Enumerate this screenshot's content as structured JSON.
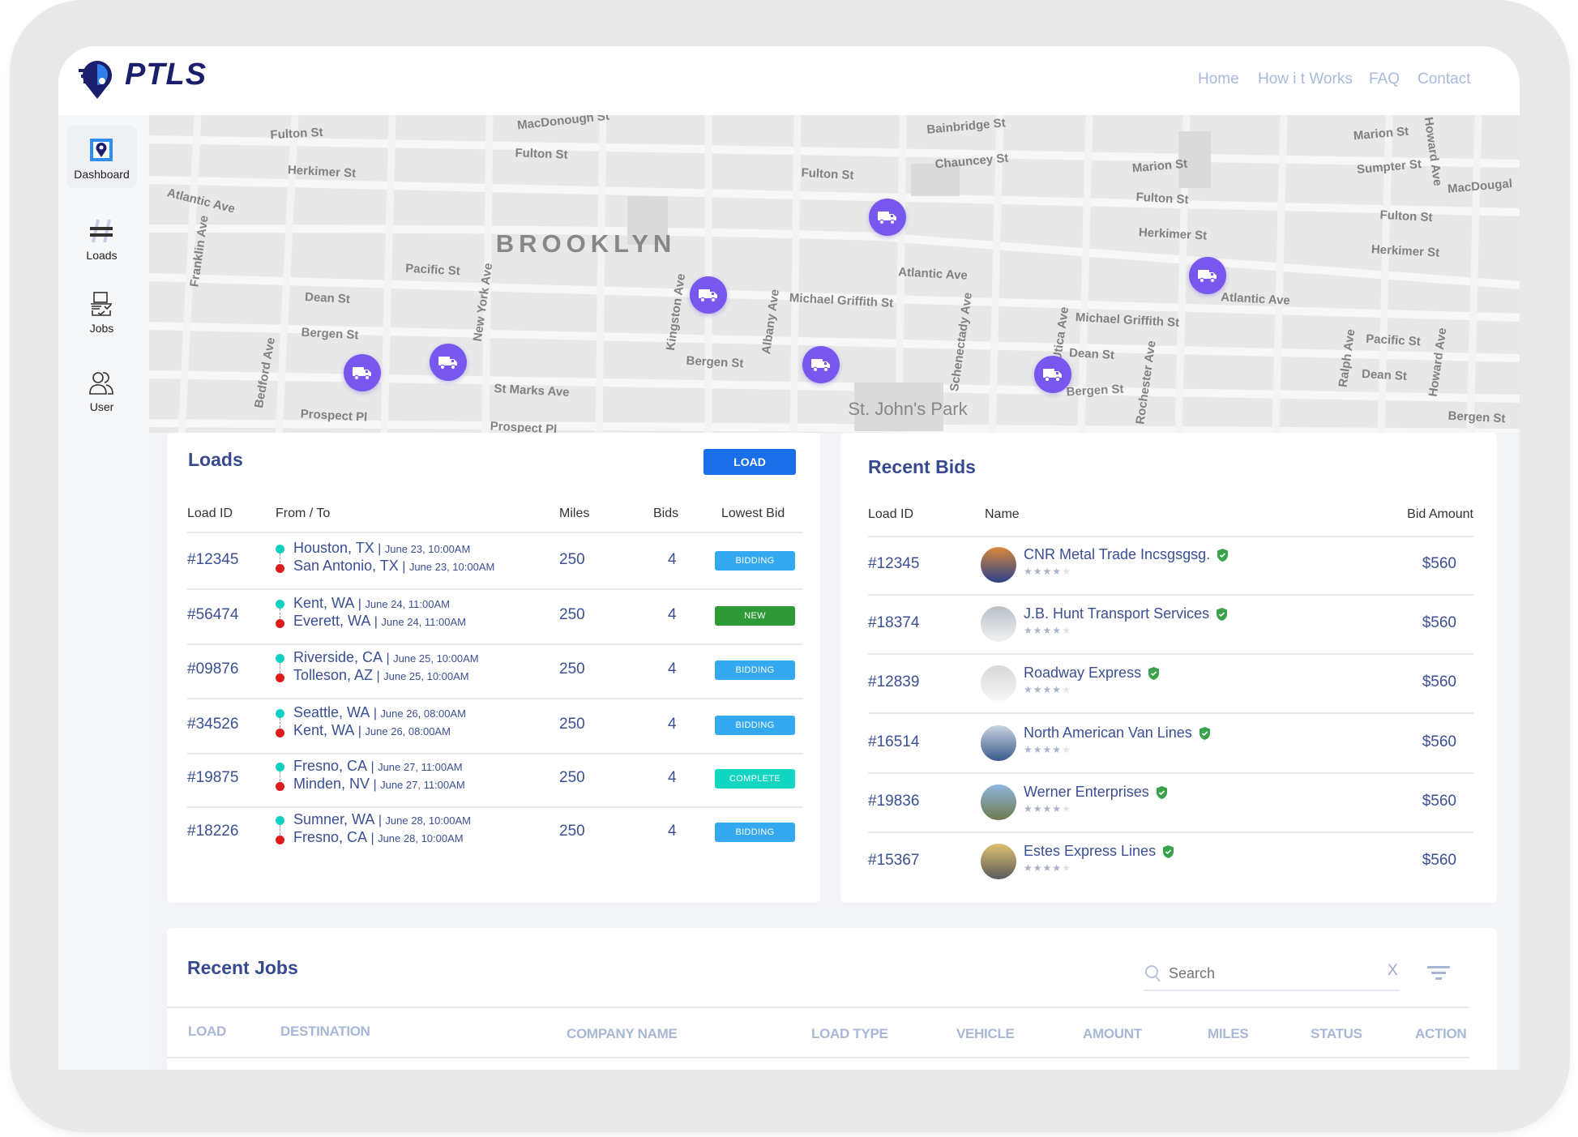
{
  "app": {
    "brand": "PTLS"
  },
  "nav": [
    {
      "label": "Home"
    },
    {
      "label": "How i t Works"
    },
    {
      "label": "FAQ"
    },
    {
      "label": "Contact"
    }
  ],
  "sidebar": {
    "items": [
      {
        "label": "Dashboard",
        "icon": "map-pin-icon",
        "active": true
      },
      {
        "label": "Loads",
        "icon": "road-icon"
      },
      {
        "label": "Jobs",
        "icon": "clipboard-icon"
      },
      {
        "label": "User",
        "icon": "users-icon"
      }
    ]
  },
  "map": {
    "marker_color": "#7857ee",
    "marker_icon": "truck-icon",
    "labels": [
      "Fulton St",
      "MacDonough St",
      "Fulton St",
      "Herkimer St",
      "Atlantic Ave",
      "Franklin Ave",
      "BROOKLYN",
      "Pacific St",
      "Dean St",
      "Bergen St",
      "New York Ave",
      "Bedford Ave",
      "Prospect Pl",
      "St Marks Ave",
      "Prospect Pl",
      "Kingston Ave",
      "Bergen St",
      "Albany Ave",
      "Michael Griffith St",
      "Fulton St",
      "Atlantic Ave",
      "Bainbridge St",
      "Chauncey St",
      "Schenectady Ave",
      "St. John's Park",
      "Utica Ave",
      "Michael Griffith St",
      "Dean St",
      "Bergen St",
      "Rochester Ave",
      "Marion St",
      "Fulton St",
      "Herkimer St",
      "Atlantic Ave",
      "Marion St",
      "Sumpter St",
      "Fulton St",
      "Herkimer St",
      "MacDougal",
      "Pacific St",
      "Dean St",
      "Ralph Ave",
      "Howard Ave",
      "Howard Ave",
      "Bergen St"
    ]
  },
  "loads": {
    "title": "Loads",
    "button": "LOAD",
    "columns": [
      "Load  ID",
      "From / To",
      "Miles",
      "Bids",
      "Lowest Bid"
    ],
    "rows": [
      {
        "id": "#12345",
        "from": "Houston, TX",
        "from_date": "June 23, 10:00AM",
        "to": "San Antonio, TX",
        "to_date": "June 23, 10:00AM",
        "miles": "250",
        "bids": "4",
        "status": "BIDDING",
        "status_color": "#35a9f0"
      },
      {
        "id": "#56474",
        "from": "Kent, WA",
        "from_date": "June 24, 11:00AM",
        "to": "Everett, WA",
        "to_date": "June 24, 11:00AM",
        "miles": "250",
        "bids": "4",
        "status": "NEW",
        "status_color": "#2e9a35"
      },
      {
        "id": "#09876",
        "from": "Riverside, CA",
        "from_date": "June 25, 10:00AM",
        "to": "Tolleson, AZ",
        "to_date": "June 25, 10:00AM",
        "miles": "250",
        "bids": "4",
        "status": "BIDDING",
        "status_color": "#35a9f0"
      },
      {
        "id": "#34526",
        "from": "Seattle, WA",
        "from_date": "June 26, 08:00AM",
        "to": "Kent, WA",
        "to_date": "June 26, 08:00AM",
        "miles": "250",
        "bids": "4",
        "status": "BIDDING",
        "status_color": "#35a9f0"
      },
      {
        "id": "#19875",
        "from": "Fresno, CA",
        "from_date": "June 27, 11:00AM",
        "to": "Minden, NV",
        "to_date": "June 27, 11:00AM",
        "miles": "250",
        "bids": "4",
        "status": "COMPLETE",
        "status_color": "#12d6c2"
      },
      {
        "id": "#18226",
        "from": "Sumner, WA",
        "from_date": "June 28, 10:00AM",
        "to": "Fresno, CA",
        "to_date": "June 28, 10:00AM",
        "miles": "250",
        "bids": "4",
        "status": "BIDDING",
        "status_color": "#35a9f0"
      }
    ]
  },
  "bids": {
    "title": "Recent Bids",
    "columns": [
      "Load  ID",
      "Name",
      "Bid Amount"
    ],
    "rows": [
      {
        "id": "#12345",
        "name": "CNR Metal Trade Incsgsgsg.",
        "rating": 4,
        "amount": "$560",
        "verified": true
      },
      {
        "id": "#18374",
        "name": "J.B. Hunt Transport Services",
        "rating": 4,
        "amount": "$560",
        "verified": true
      },
      {
        "id": "#12839",
        "name": "Roadway Express",
        "rating": 4,
        "amount": "$560",
        "verified": true
      },
      {
        "id": "#16514",
        "name": "North American Van Lines",
        "rating": 4,
        "amount": "$560",
        "verified": true
      },
      {
        "id": "#19836",
        "name": "Werner Enterprises",
        "rating": 4,
        "amount": "$560",
        "verified": true
      },
      {
        "id": "#15367",
        "name": "Estes Express Lines",
        "rating": 4,
        "amount": "$560",
        "verified": true
      }
    ]
  },
  "jobs": {
    "title": "Recent Jobs",
    "search_placeholder": "Search",
    "clear_label": "X",
    "columns": [
      "LOAD",
      "DESTINATION",
      "COMPANY NAME",
      "LOAD TYPE",
      "VEHICLE",
      "AMOUNT",
      "MILES",
      "STATUS",
      "ACTION"
    ]
  },
  "colors": {
    "accent": "#1a6fe8",
    "title": "#384a8f",
    "text": "#3b4f94",
    "origin_dot": "#12cfc0",
    "dest_dot": "#e01b1b",
    "verified": "#3aa24a"
  }
}
